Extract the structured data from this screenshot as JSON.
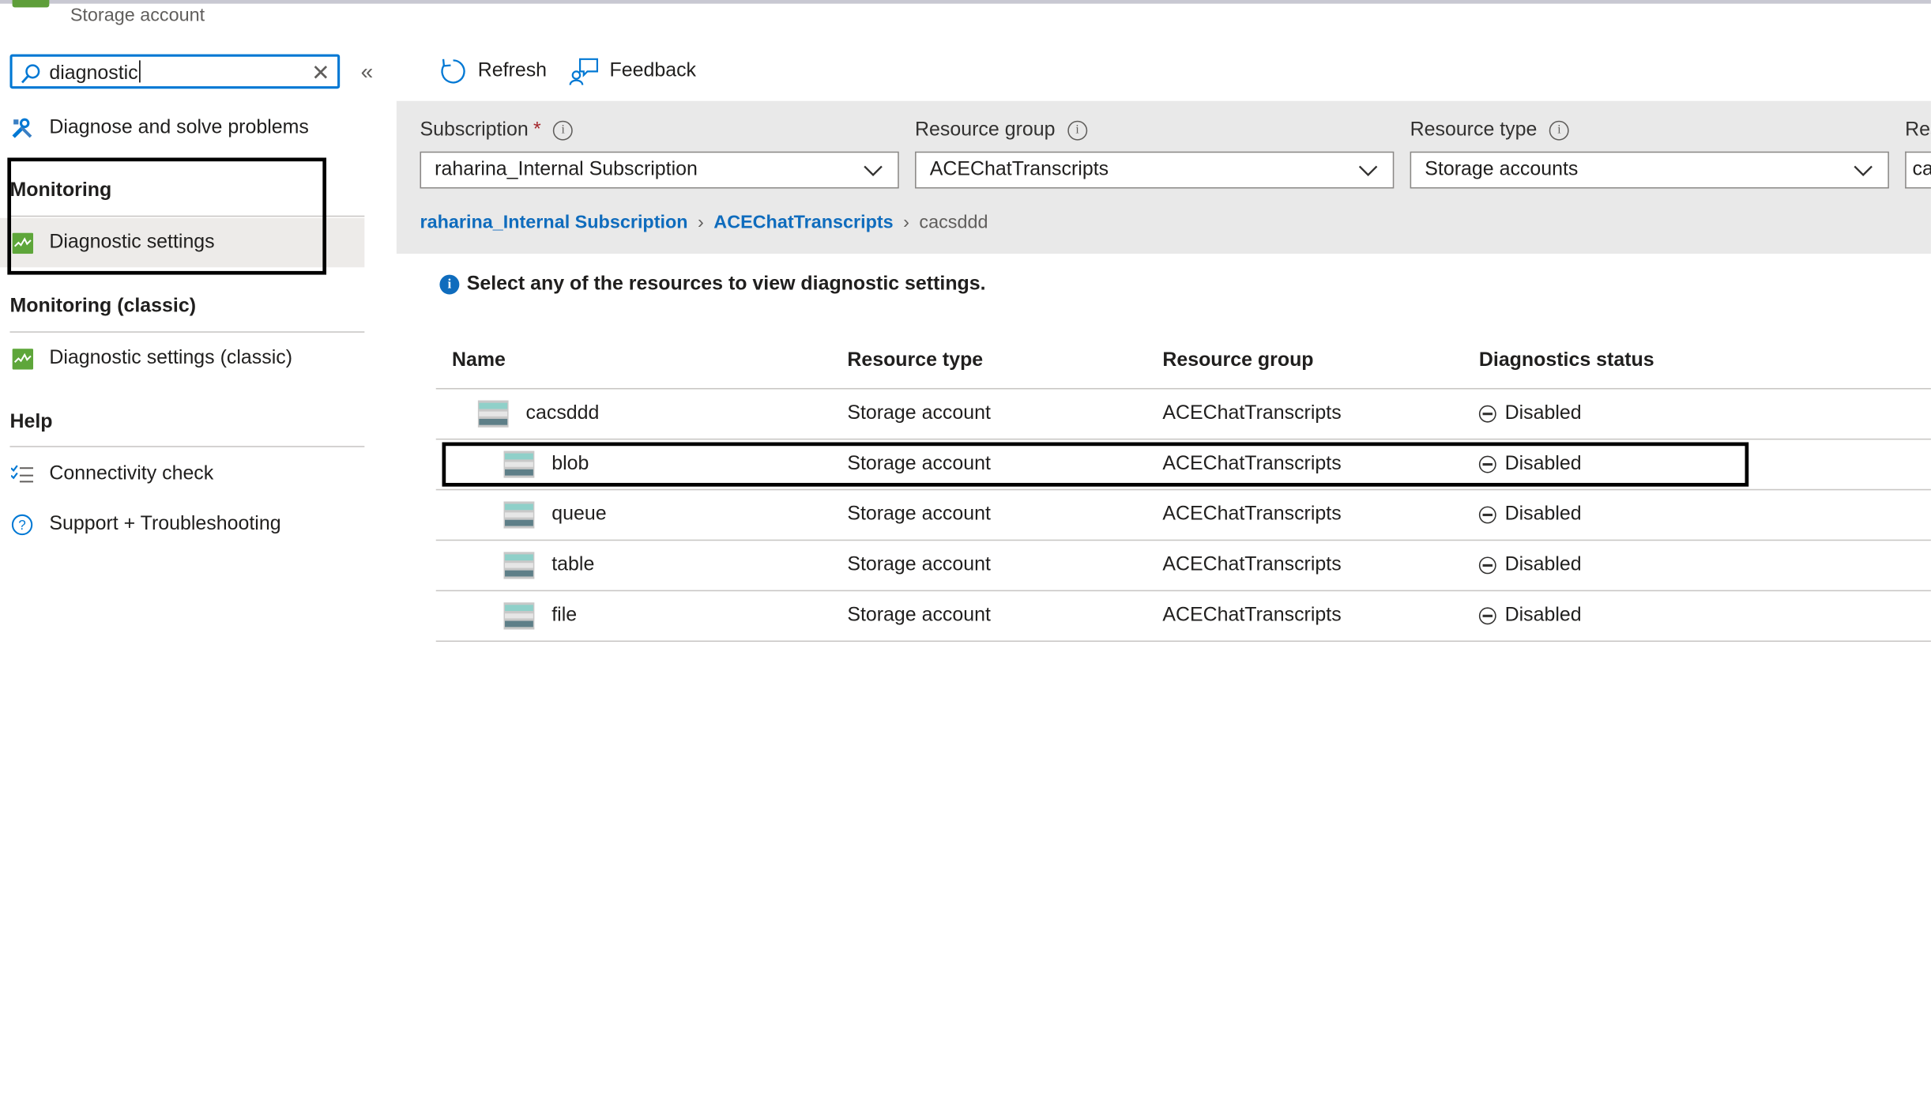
{
  "header": {
    "subtitle": "Storage account"
  },
  "search": {
    "value": "diagnostic",
    "clear_icon": "close-icon"
  },
  "sidebar": {
    "items_top": [
      {
        "label": "Diagnose and solve problems",
        "icon": "wrench-icon"
      }
    ],
    "sections": [
      {
        "heading": "Monitoring",
        "items": [
          {
            "label": "Diagnostic settings",
            "icon": "diagnostic-settings-icon",
            "selected": true
          }
        ]
      },
      {
        "heading": "Monitoring (classic)",
        "items": [
          {
            "label": "Diagnostic settings (classic)",
            "icon": "diagnostic-settings-icon"
          }
        ]
      },
      {
        "heading": "Help",
        "items": [
          {
            "label": "Connectivity check",
            "icon": "checklist-icon"
          },
          {
            "label": "Support + Troubleshooting",
            "icon": "question-icon"
          }
        ]
      }
    ]
  },
  "toolbar": {
    "refresh": "Refresh",
    "feedback": "Feedback"
  },
  "filters": {
    "subscription": {
      "label": "Subscription",
      "required": "*",
      "value": "raharina_Internal Subscription"
    },
    "resource_group": {
      "label": "Resource group",
      "value": "ACEChatTranscripts"
    },
    "resource_type": {
      "label": "Resource type",
      "value": "Storage accounts"
    },
    "resource": {
      "label": "Res",
      "value": "ca"
    }
  },
  "breadcrumb": [
    "raharina_Internal Subscription",
    "ACEChatTranscripts",
    "cacsddd"
  ],
  "info_text": "Select any of the resources to view diagnostic settings.",
  "table": {
    "headers": [
      "Name",
      "Resource type",
      "Resource group",
      "Diagnostics status"
    ],
    "rows": [
      {
        "name": "cacsddd",
        "type": "Storage account",
        "group": "ACEChatTranscripts",
        "status": "Disabled",
        "indent": 0
      },
      {
        "name": "blob",
        "type": "Storage account",
        "group": "ACEChatTranscripts",
        "status": "Disabled",
        "indent": 1
      },
      {
        "name": "queue",
        "type": "Storage account",
        "group": "ACEChatTranscripts",
        "status": "Disabled",
        "indent": 1
      },
      {
        "name": "table",
        "type": "Storage account",
        "group": "ACEChatTranscripts",
        "status": "Disabled",
        "indent": 1
      },
      {
        "name": "file",
        "type": "Storage account",
        "group": "ACEChatTranscripts",
        "status": "Disabled",
        "indent": 1
      }
    ]
  },
  "colors": {
    "accent": "#0078d4",
    "link": "#0f6cbd",
    "panel": "#e9e9e9",
    "highlight_box": "#000000"
  }
}
